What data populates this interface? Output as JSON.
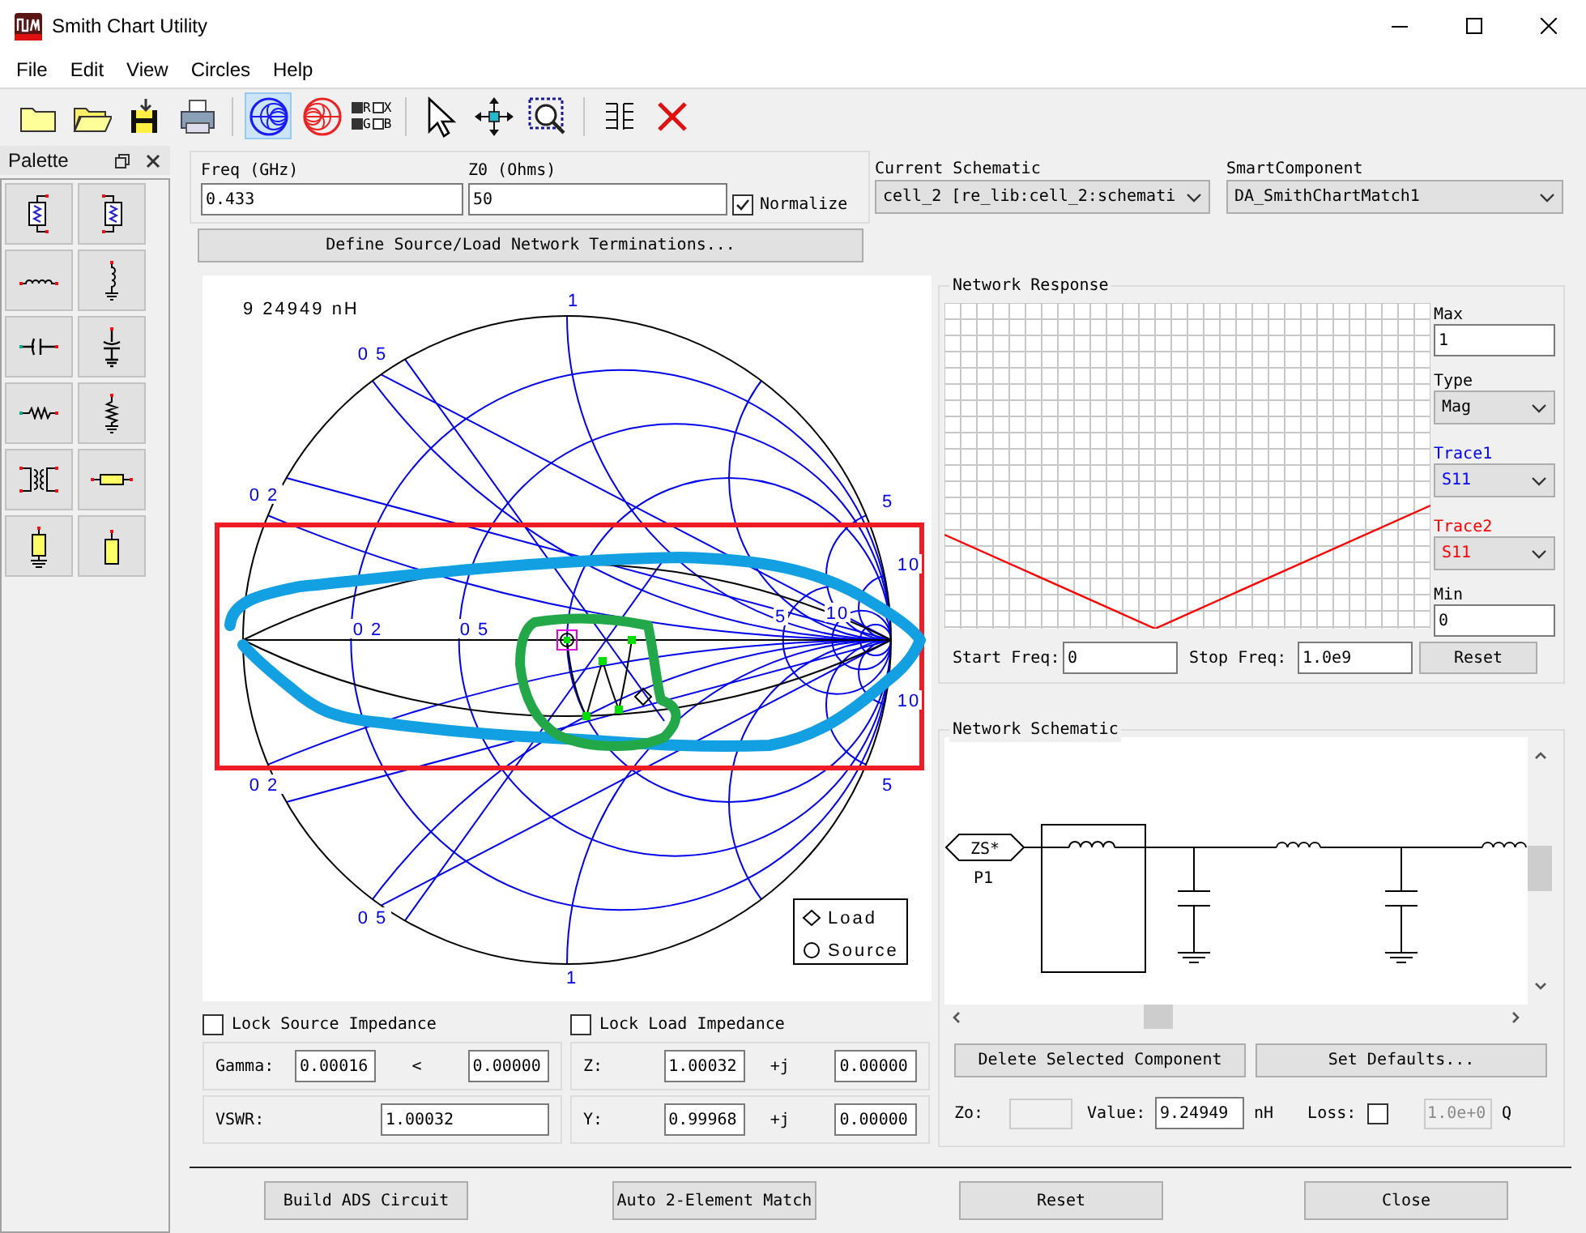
{
  "window": {
    "title": "Smith Chart Utility"
  },
  "menu": [
    "File",
    "Edit",
    "View",
    "Circles",
    "Help"
  ],
  "toolbar": {
    "groups": [
      [
        {
          "kind": "new",
          "selected": false
        },
        {
          "kind": "open",
          "selected": false
        },
        {
          "kind": "save",
          "selected": false
        },
        {
          "kind": "print",
          "selected": false
        }
      ],
      [
        {
          "kind": "smith_z",
          "selected": true
        },
        {
          "kind": "smith_y",
          "selected": false
        },
        {
          "kind": "toggles",
          "toggles": [
            {
              "label": "R",
              "checked": true
            },
            {
              "label": "X",
              "checked": false
            },
            {
              "label": "G",
              "checked": true
            },
            {
              "label": "B",
              "checked": false
            }
          ]
        }
      ],
      [
        {
          "kind": "pointer",
          "selected": false
        },
        {
          "kind": "move",
          "selected": false
        },
        {
          "kind": "zoom",
          "selected": false
        }
      ],
      [
        {
          "kind": "grid",
          "selected": false
        },
        {
          "kind": "delete",
          "selected": false
        }
      ]
    ]
  },
  "palette": {
    "title": "Palette",
    "items": [
      {
        "kind": "shunt_network"
      },
      {
        "kind": "series_network"
      },
      {
        "kind": "series_inductor"
      },
      {
        "kind": "shunt_inductor"
      },
      {
        "kind": "series_capacitor"
      },
      {
        "kind": "shunt_capacitor"
      },
      {
        "kind": "series_resistor"
      },
      {
        "kind": "shunt_resistor"
      },
      {
        "kind": "transformer"
      },
      {
        "kind": "series_line"
      },
      {
        "kind": "shunt_line_grounded"
      },
      {
        "kind": "shunt_line_open"
      }
    ]
  },
  "settings": {
    "freq": {
      "label": "Freq (GHz)",
      "value": "0.433"
    },
    "z0": {
      "label": "Z0 (Ohms)",
      "value": "50"
    },
    "normalize": {
      "label": "Normalize",
      "checked": true
    }
  },
  "define_button": "Define Source/Load Network Terminations...",
  "current_schematic": {
    "label": "Current Schematic",
    "value": "cell_2 [re_lib:cell_2:schemati"
  },
  "smart_component": {
    "label": "SmartComponent",
    "value": "DA_SmithChartMatch1"
  },
  "smith_chart": {
    "readout": "9 24949 nH",
    "labels": [
      "1",
      "0 5",
      "0 2",
      "5",
      "10",
      "0 2",
      "0 5",
      "5",
      "10",
      "10",
      "0 2",
      "5",
      "0 5",
      "1"
    ],
    "legend": [
      {
        "kind": "load",
        "label": "Load"
      },
      {
        "kind": "source",
        "label": "Source"
      }
    ]
  },
  "lock_source": {
    "label": "Lock Source Impedance",
    "checked": false
  },
  "lock_load": {
    "label": "Lock Load Impedance",
    "checked": false
  },
  "gamma": {
    "label": "Gamma:",
    "magnitude": "0.00016",
    "angle_sign": "<",
    "angle": "0.00000"
  },
  "vswr": {
    "label": "VSWR:",
    "value": "1.00032"
  },
  "z": {
    "label": "Z:",
    "real": "1.00032",
    "j": "+j",
    "imag": "0.00000"
  },
  "y": {
    "label": "Y:",
    "real": "0.99968",
    "j": "+j",
    "imag": "0.00000"
  },
  "network_response": {
    "title": "Network Response",
    "max": {
      "label": "Max",
      "value": "1"
    },
    "type": {
      "label": "Type",
      "value": "Mag"
    },
    "traces": [
      {
        "label": "Trace1",
        "value": "S11",
        "color": "#0000ff"
      },
      {
        "label": "Trace2",
        "value": "S11",
        "color": "#ff0000"
      }
    ],
    "min": {
      "label": "Min",
      "value": "0"
    },
    "start_freq": {
      "label": "Start Freq:",
      "value": "0"
    },
    "stop_freq": {
      "label": "Stop Freq:",
      "value": "1.0e9"
    },
    "reset": "Reset"
  },
  "network_schematic": {
    "title": "Network Schematic",
    "port_label": "ZS*",
    "port_name": "P1",
    "delete_button": "Delete Selected Component",
    "defaults_button": "Set Defaults...",
    "zo_label": "Zo:",
    "value": {
      "label": "Value:",
      "value": "9.24949",
      "unit": "nH"
    },
    "loss": {
      "label": "Loss:",
      "checked": false,
      "q_value": "1.0e+0",
      "q_label": "Q"
    }
  },
  "buttons": [
    "Build ADS Circuit",
    "Auto 2-Element Match",
    "Reset",
    "Close"
  ]
}
